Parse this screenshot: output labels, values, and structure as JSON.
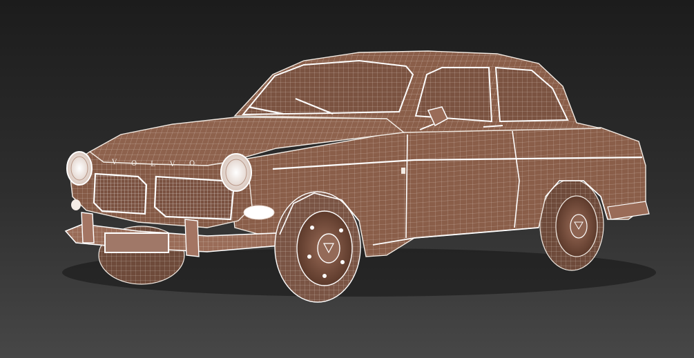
{
  "scene": {
    "description_label": "",
    "colors": {
      "background_top": "#1c1c1c",
      "background_bottom": "#474747",
      "body": "#8a5e49",
      "body_dark": "#6d4634",
      "body_shadow": "#4c2f22",
      "wire": "#f2ebe4",
      "wire_soft": "#c9ada0",
      "glass": "#7b5341",
      "tire": "#7a5444"
    },
    "logo_text": "VOLVO",
    "logo_letters": [
      "V",
      "O",
      "L",
      "V",
      "O"
    ]
  }
}
